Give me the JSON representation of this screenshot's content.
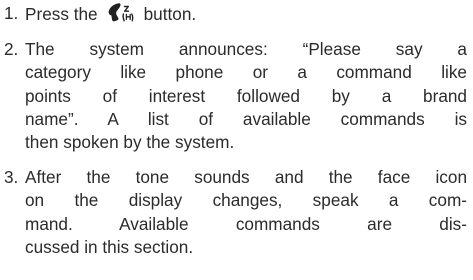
{
  "steps": [
    {
      "number": "1.",
      "before_icon": "Press the",
      "icon": "talk-voice-icon",
      "after_icon": "button."
    },
    {
      "number": "2.",
      "lines": [
        "The system announces: “Please say a",
        "category like phone or a command like",
        "points of interest followed by a brand",
        "name”. A list of available commands is",
        "then spoken by the system."
      ]
    },
    {
      "number": "3.",
      "lines": [
        "After the tone sounds and the face icon",
        "on the display changes, speak a com-",
        "mand. Available commands are dis-",
        "cussed in this section."
      ]
    }
  ]
}
